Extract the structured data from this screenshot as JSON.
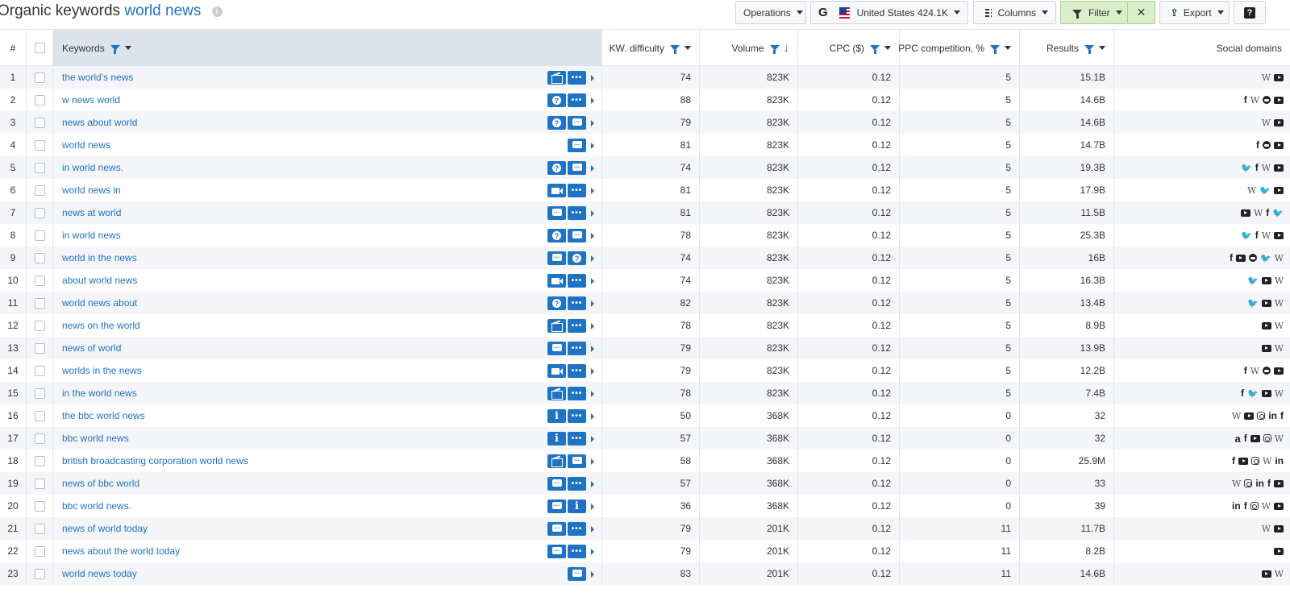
{
  "header": {
    "title_prefix": "Organic keywords",
    "title_keyword": "world news",
    "info_icon": "info-icon"
  },
  "toolbar": {
    "operations_label": "Operations",
    "engine_logo": "G",
    "country_label": "United States 424.1K",
    "columns_label": "Columns",
    "filter_label": "Filter",
    "clear_filter_label": "✕",
    "export_label": "Export",
    "help_label": "?"
  },
  "columns": {
    "num": "#",
    "keywords": "Keywords",
    "kd": "KW. difficulty",
    "volume": "Volume",
    "cpc": "CPC ($)",
    "ppc": "PPC competition, %",
    "results": "Results",
    "social": "Social domains"
  },
  "rows": [
    {
      "n": "1",
      "kw": "the world's news",
      "feat": [
        "news",
        "dots"
      ],
      "kd": "74",
      "vol": "823K",
      "cpc": "0.12",
      "ppc": "5",
      "res": "15.1B",
      "soc": [
        "wiki",
        "yt"
      ]
    },
    {
      "n": "2",
      "kw": "w news world",
      "feat": [
        "question",
        "dots"
      ],
      "kd": "88",
      "vol": "823K",
      "cpc": "0.12",
      "ppc": "5",
      "res": "14.6B",
      "soc": [
        "fb",
        "wiki",
        "rd",
        "yt"
      ]
    },
    {
      "n": "3",
      "kw": "news about world",
      "feat": [
        "question",
        "chat"
      ],
      "kd": "79",
      "vol": "823K",
      "cpc": "0.12",
      "ppc": "5",
      "res": "14.6B",
      "soc": [
        "wiki",
        "yt"
      ]
    },
    {
      "n": "4",
      "kw": "world news",
      "feat": [
        "chat"
      ],
      "kd": "81",
      "vol": "823K",
      "cpc": "0.12",
      "ppc": "5",
      "res": "14.7B",
      "soc": [
        "fb",
        "rd",
        "yt"
      ]
    },
    {
      "n": "5",
      "kw": "in world news.",
      "feat": [
        "question",
        "chat"
      ],
      "kd": "74",
      "vol": "823K",
      "cpc": "0.12",
      "ppc": "5",
      "res": "19.3B",
      "soc": [
        "tw",
        "fb",
        "wiki",
        "yt"
      ]
    },
    {
      "n": "6",
      "kw": "world news in",
      "feat": [
        "video",
        "dots"
      ],
      "kd": "81",
      "vol": "823K",
      "cpc": "0.12",
      "ppc": "5",
      "res": "17.9B",
      "soc": [
        "wiki",
        "tw",
        "yt"
      ]
    },
    {
      "n": "7",
      "kw": "news at world",
      "feat": [
        "chat",
        "dots"
      ],
      "kd": "81",
      "vol": "823K",
      "cpc": "0.12",
      "ppc": "5",
      "res": "11.5B",
      "soc": [
        "yt",
        "wiki",
        "fb",
        "tw"
      ]
    },
    {
      "n": "8",
      "kw": "in world news",
      "feat": [
        "question",
        "chat"
      ],
      "kd": "78",
      "vol": "823K",
      "cpc": "0.12",
      "ppc": "5",
      "res": "25.3B",
      "soc": [
        "tw",
        "fb",
        "wiki",
        "yt"
      ]
    },
    {
      "n": "9",
      "kw": "world in the news",
      "feat": [
        "chat",
        "question"
      ],
      "kd": "74",
      "vol": "823K",
      "cpc": "0.12",
      "ppc": "5",
      "res": "16B",
      "soc": [
        "fb",
        "yt",
        "rd",
        "tw",
        "wiki"
      ]
    },
    {
      "n": "10",
      "kw": "about world news",
      "feat": [
        "video",
        "dots"
      ],
      "kd": "74",
      "vol": "823K",
      "cpc": "0.12",
      "ppc": "5",
      "res": "16.3B",
      "soc": [
        "tw",
        "yt",
        "wiki"
      ]
    },
    {
      "n": "11",
      "kw": "world news about",
      "feat": [
        "question",
        "dots"
      ],
      "kd": "82",
      "vol": "823K",
      "cpc": "0.12",
      "ppc": "5",
      "res": "13.4B",
      "soc": [
        "tw",
        "yt",
        "wiki"
      ]
    },
    {
      "n": "12",
      "kw": "news on the world",
      "feat": [
        "news",
        "dots"
      ],
      "kd": "78",
      "vol": "823K",
      "cpc": "0.12",
      "ppc": "5",
      "res": "8.9B",
      "soc": [
        "yt",
        "wiki"
      ]
    },
    {
      "n": "13",
      "kw": "news of world",
      "feat": [
        "chat",
        "dots"
      ],
      "kd": "79",
      "vol": "823K",
      "cpc": "0.12",
      "ppc": "5",
      "res": "13.9B",
      "soc": [
        "yt",
        "wiki"
      ]
    },
    {
      "n": "14",
      "kw": "worlds in the news",
      "feat": [
        "video",
        "dots"
      ],
      "kd": "79",
      "vol": "823K",
      "cpc": "0.12",
      "ppc": "5",
      "res": "12.2B",
      "soc": [
        "fb",
        "wiki",
        "rd",
        "yt"
      ]
    },
    {
      "n": "15",
      "kw": "in the world news",
      "feat": [
        "news",
        "dots"
      ],
      "kd": "78",
      "vol": "823K",
      "cpc": "0.12",
      "ppc": "5",
      "res": "7.4B",
      "soc": [
        "fb",
        "tw",
        "yt",
        "wiki"
      ]
    },
    {
      "n": "16",
      "kw": "the bbc world news",
      "feat": [
        "info",
        "dots"
      ],
      "kd": "50",
      "vol": "368K",
      "cpc": "0.12",
      "ppc": "0",
      "res": "32",
      "soc": [
        "wiki",
        "yt",
        "ig",
        "li",
        "fb"
      ]
    },
    {
      "n": "17",
      "kw": "bbc world news",
      "feat": [
        "info",
        "dots"
      ],
      "kd": "57",
      "vol": "368K",
      "cpc": "0.12",
      "ppc": "0",
      "res": "32",
      "soc": [
        "amz",
        "fb",
        "yt",
        "ig",
        "wiki"
      ]
    },
    {
      "n": "18",
      "kw": "british broadcasting corporation world news",
      "feat": [
        "news",
        "chat"
      ],
      "kd": "58",
      "vol": "368K",
      "cpc": "0.12",
      "ppc": "0",
      "res": "25.9M",
      "soc": [
        "fb",
        "yt",
        "ig",
        "wiki",
        "li"
      ]
    },
    {
      "n": "19",
      "kw": "news of bbc world",
      "feat": [
        "chat",
        "dots"
      ],
      "kd": "57",
      "vol": "368K",
      "cpc": "0.12",
      "ppc": "0",
      "res": "33",
      "soc": [
        "wiki",
        "ig",
        "li",
        "fb",
        "yt"
      ]
    },
    {
      "n": "20",
      "kw": "bbc world news.",
      "feat": [
        "chat",
        "info"
      ],
      "kd": "36",
      "vol": "368K",
      "cpc": "0.12",
      "ppc": "0",
      "res": "39",
      "soc": [
        "li",
        "fb",
        "ig",
        "wiki",
        "yt"
      ]
    },
    {
      "n": "21",
      "kw": "news of world today",
      "feat": [
        "chat",
        "dots"
      ],
      "kd": "79",
      "vol": "201K",
      "cpc": "0.12",
      "ppc": "11",
      "res": "11.7B",
      "soc": [
        "wiki",
        "yt"
      ]
    },
    {
      "n": "22",
      "kw": "news about the world today",
      "feat": [
        "chat",
        "dots"
      ],
      "kd": "79",
      "vol": "201K",
      "cpc": "0.12",
      "ppc": "11",
      "res": "8.2B",
      "soc": [
        "yt"
      ]
    },
    {
      "n": "23",
      "kw": "world news today",
      "feat": [
        "chat"
      ],
      "kd": "83",
      "vol": "201K",
      "cpc": "0.12",
      "ppc": "11",
      "res": "14.6B",
      "soc": [
        "yt",
        "wiki"
      ]
    }
  ],
  "icon_glyphs": {
    "wiki": "W",
    "fb": "f",
    "tw": "🐦",
    "li": "in",
    "amz": "a"
  },
  "colors": {
    "link": "#1f73c4",
    "header_kw_bg": "#dde3ec",
    "filter_active_bg": "#d9efc9",
    "row_alt": "#f4f5f8"
  }
}
